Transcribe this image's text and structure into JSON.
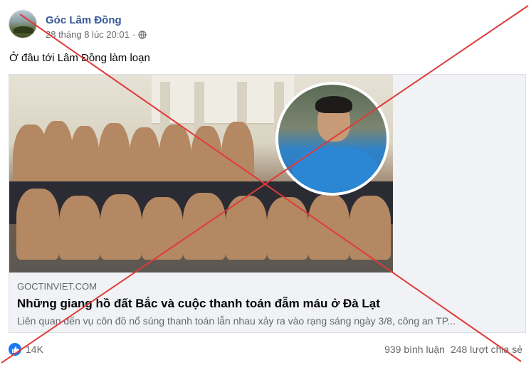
{
  "post": {
    "page_name": "Góc Lâm Đồng",
    "timestamp": "28 tháng 8 lúc 20:01",
    "separator": "·",
    "text": "Ở đâu tới Lâm Đồng làm loạn"
  },
  "link_card": {
    "domain": "GOCTINVIET.COM",
    "title": "Những giang hồ đất Bắc và cuộc thanh toán đẫm máu ở Đà Lạt",
    "description": "Liên quan đến vụ côn đồ nổ súng thanh toán lẫn nhau xảy ra vào rạng sáng ngày 3/8, công an TP..."
  },
  "footer": {
    "reaction_count": "14K",
    "comments": "939 bình luận",
    "shares": "248 lượt chia sẻ"
  },
  "icons": {
    "like": "like-icon",
    "globe": "globe-icon"
  },
  "colors": {
    "cross": "#e03a3a",
    "page_name": "#385898",
    "like_badge": "#1877f2"
  }
}
